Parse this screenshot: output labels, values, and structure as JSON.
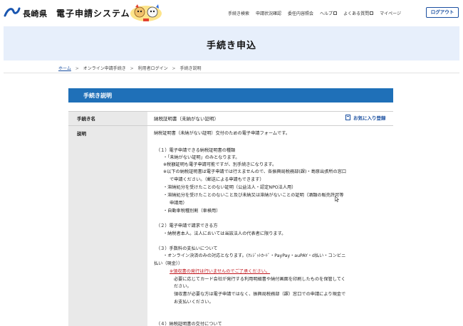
{
  "header": {
    "pref_name": "長崎県",
    "system_name": "電子申請システム",
    "nav": [
      {
        "label": "手続き検索",
        "external": false
      },
      {
        "label": "申請状況確認",
        "external": false
      },
      {
        "label": "委任内容照会",
        "external": false
      },
      {
        "label": "ヘルプ",
        "external": true
      },
      {
        "label": "よくある質問",
        "external": true
      },
      {
        "label": "マイページ",
        "external": false
      }
    ],
    "logout_label": "ログアウト"
  },
  "page": {
    "title": "手続き申込"
  },
  "breadcrumb": [
    "ホーム",
    "オンライン申請手続き",
    "利用者ログイン",
    "手続き説明"
  ],
  "section": {
    "title": "手続き説明",
    "rows": {
      "procedure_label": "手続き名",
      "procedure_value": "納税証明書（未納がない証明）",
      "favorite_label": "お気に入り登録",
      "description_label": "説明"
    }
  },
  "description": {
    "intro": "納税証明書（未納がない証明）交付のための電子申請フォームです。",
    "s1_title": "（１）電子申請できる納税証明書の種類",
    "s1_l1": "・「未納がない証明」のみとなります。",
    "s1_l2": "※税額証明も電子申請可能ですが、別手続きになります。",
    "s1_l3": "※以下の納税証明書は電子申請では行えませんので、各振興局税務部(課)・島原出張所の窓口",
    "s1_l4": "で申請ください。（郵送による申請もできます）",
    "s1_l5": "・滞納処分を受けたことのない証明（公益法人・認定NPO法人用）",
    "s1_l6": "・滞納処分を受けたことのないこと及び未納又は滞納がないことの証明（酒類の販売許可等",
    "s1_l7": "申請用）",
    "s1_l8": "・自動車税種別割（車検用）",
    "s2_title": "（２）電子申請で請求できる方",
    "s2_l1": "・納税者本人。法人においては当該法人の代表者に限ります。",
    "s3_title": "（３）手数料の支払いについて",
    "s3_l1": "・オンライン決済のみの対応となります。(ｸﾚｼﾞｯﾄｶｰﾄﾞ・PayPay・auPAY・d払い・コンビニ",
    "s3_l2": "払い（現金））",
    "s3_note": "※領収書の発行は行いませんのでご了承ください。",
    "s3_l3": "必要に応じてカード会社が発行する利用明細書や納付画面を印刷したものを保管してく",
    "s3_l4": "ださい。",
    "s3_l5": "領収書が必要な方は電子申請ではなく、振興局税務部（課）窓口での申請により現金で",
    "s3_l6": "お支払いください。",
    "s4_title": "（４）納税証明書の交付について"
  },
  "colors": {
    "accent": "#1f70b8",
    "link": "#1a4fa0",
    "title_band": "#e7effb",
    "label_bg": "#e9e9e9",
    "warning": "#c0151b"
  }
}
